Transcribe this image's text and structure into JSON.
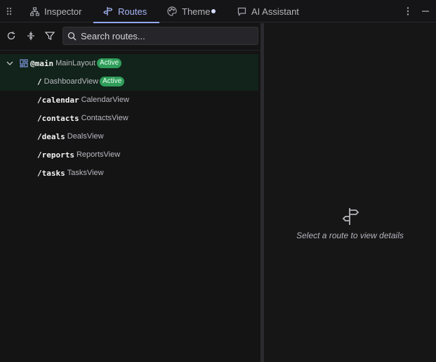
{
  "tabs": [
    {
      "label": "Inspector",
      "icon": "hierarchy-icon",
      "active": false
    },
    {
      "label": "Routes",
      "icon": "signpost-icon",
      "active": true
    },
    {
      "label": "Theme",
      "icon": "palette-icon",
      "active": false,
      "has_dot": true
    },
    {
      "label": "AI Assistant",
      "icon": "chat-icon",
      "active": false
    }
  ],
  "search": {
    "placeholder": "Search routes..."
  },
  "routes": [
    {
      "path": "@main",
      "component": "MainLayout",
      "badge": "Active",
      "level": 0,
      "expanded": true
    },
    {
      "path": "/",
      "component": "DashboardView",
      "badge": "Active",
      "level": 1
    },
    {
      "path": "/calendar",
      "component": "CalendarView",
      "level": 1
    },
    {
      "path": "/contacts",
      "component": "ContactsView",
      "level": 1
    },
    {
      "path": "/deals",
      "component": "DealsView",
      "level": 1
    },
    {
      "path": "/reports",
      "component": "ReportsView",
      "level": 1
    },
    {
      "path": "/tasks",
      "component": "TasksView",
      "level": 1
    }
  ],
  "detail": {
    "empty_text": "Select a route to view details"
  },
  "colors": {
    "accent": "#93a6f5",
    "active_badge": "#2f9d5a",
    "selected_row": "#11231a"
  }
}
